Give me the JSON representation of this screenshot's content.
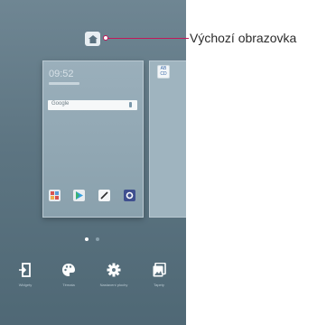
{
  "callout": {
    "label": "Výchozí obrazovka"
  },
  "preview": {
    "clock": "09:52",
    "search_brand": "Google"
  },
  "side_preview": {
    "icon_text": "AB\nCD"
  },
  "pager": {
    "page_count": 2,
    "active_page": 1
  },
  "bottom_actions": [
    {
      "icon": "widgets-icon",
      "label": "Widgety"
    },
    {
      "icon": "theme-icon",
      "label": "Témata"
    },
    {
      "icon": "settings-icon",
      "label": "Nastavení plochy"
    },
    {
      "icon": "wallpaper-icon",
      "label": "Tapety"
    }
  ],
  "colors": {
    "accent": "#c0175a",
    "screen_bg": "#5f7784"
  }
}
